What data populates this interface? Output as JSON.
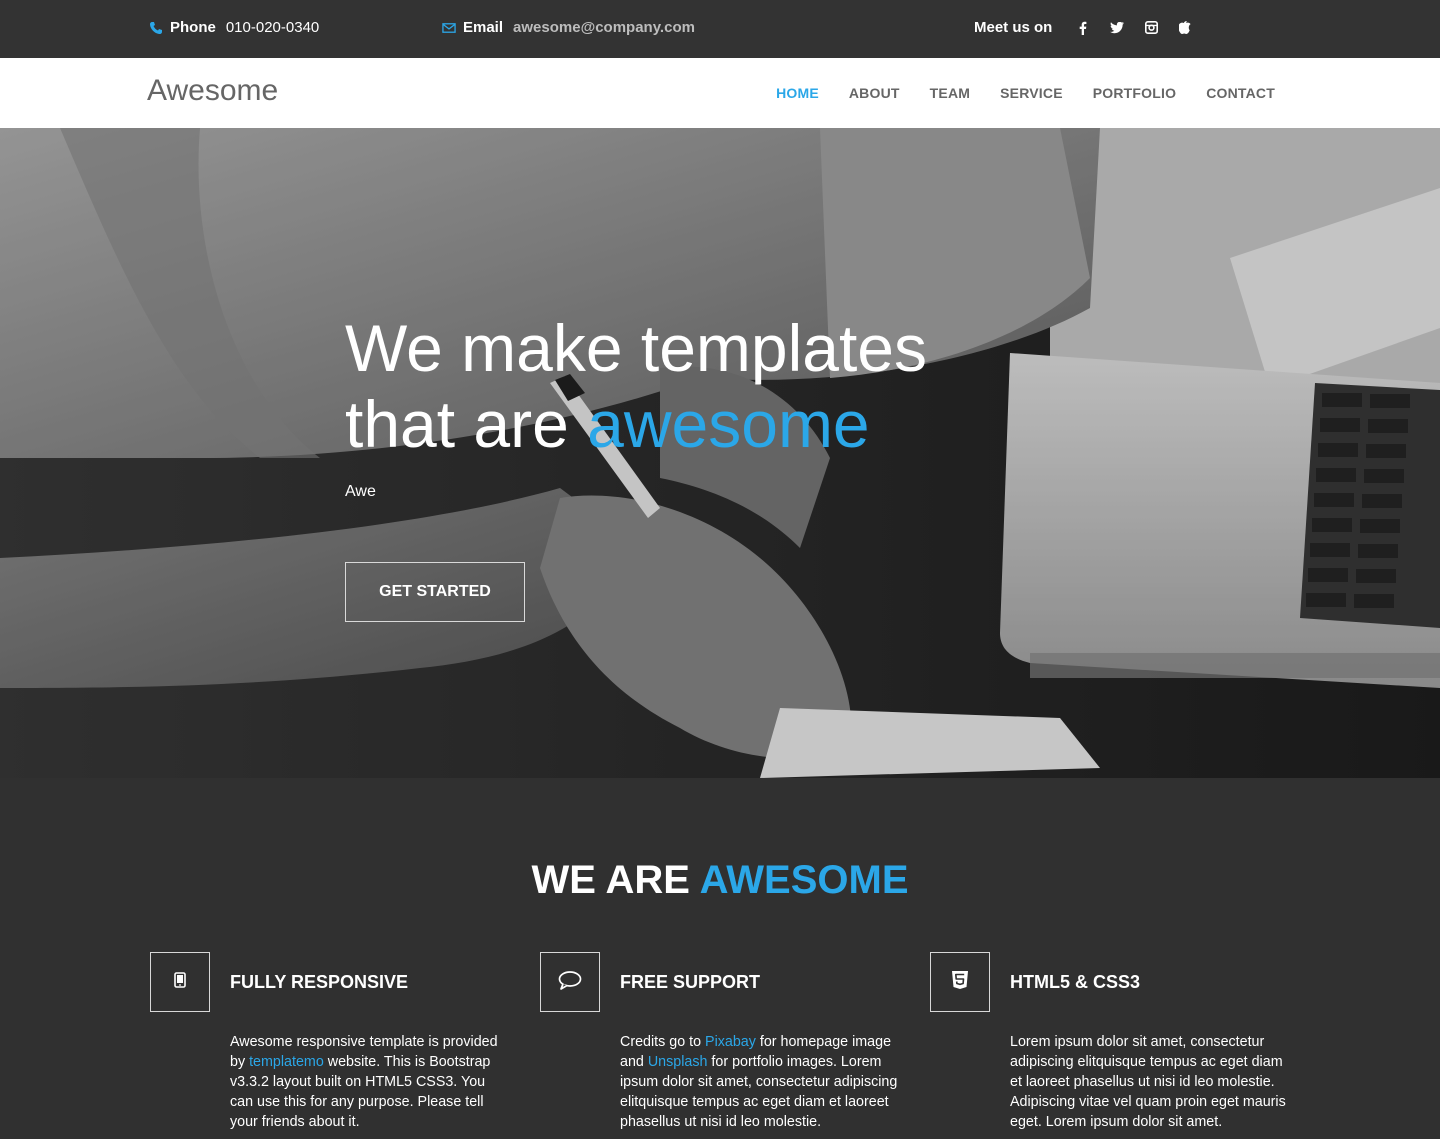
{
  "topbar": {
    "phone_label": "Phone",
    "phone_value": "010-020-0340",
    "email_label": "Email",
    "email_value": "awesome@company.com",
    "social_label": "Meet us on",
    "social_icons": [
      "facebook-icon",
      "twitter-icon",
      "instagram-icon",
      "apple-icon"
    ]
  },
  "nav": {
    "brand": "Awesome",
    "items": [
      "HOME",
      "ABOUT",
      "TEAM",
      "SERVICE",
      "PORTFOLIO",
      "CONTACT"
    ],
    "active": "HOME"
  },
  "hero": {
    "title_line1": "We make templates",
    "title_line2_prefix": "that are ",
    "title_line2_accent": "awesome",
    "subtitle": "Awe",
    "cta": "GET STARTED"
  },
  "features": {
    "heading_prefix": "WE ARE ",
    "heading_accent": "AWESOME",
    "items": [
      {
        "icon": "mobile-icon",
        "title": "FULLY RESPONSIVE",
        "t1": "Awesome responsive template is provided by ",
        "link1": "templatemo",
        "t2": " website. This is Bootstrap v3.3.2 layout built on HTML5 CSS3. You can use this for any purpose. Please tell your friends about it."
      },
      {
        "icon": "comment-icon",
        "title": "FREE SUPPORT",
        "t1": "Credits go to ",
        "link1": "Pixabay",
        "t2": " for homepage image and ",
        "link2": "Unsplash",
        "t3": " for portfolio images. Lorem ipsum dolor sit amet, consectetur adipiscing elitquisque tempus ac eget diam et laoreet phasellus ut nisi id leo molestie."
      },
      {
        "icon": "html5-icon",
        "title": "HTML5 & CSS3",
        "t1": "Lorem ipsum dolor sit amet, consectetur adipiscing elitquisque tempus ac eget diam et laoreet phasellus ut nisi id leo molestie. Adipiscing vitae vel quam proin eget mauris eget. Lorem ipsum dolor sit amet."
      }
    ]
  },
  "colors": {
    "accent": "#2ba7e8",
    "topbar": "#333333",
    "dark": "#303030"
  }
}
